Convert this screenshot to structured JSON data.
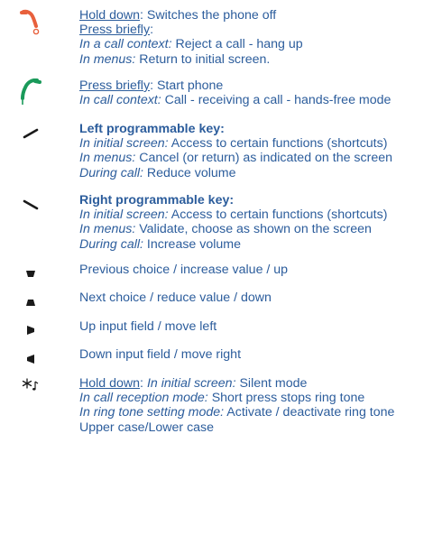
{
  "colors": {
    "text": "#2c5d9c",
    "end_key": "#e8603c",
    "call_key": "#1a9a5a",
    "dark": "#1a1a1a"
  },
  "entries": [
    {
      "icon": "end-call-icon",
      "lines": [
        [
          {
            "t": "Hold down",
            "s": "u"
          },
          {
            "t": ": Switches the phone off",
            "s": ""
          }
        ],
        [
          {
            "t": "Press briefly",
            "s": "u"
          },
          {
            "t": ":",
            "s": ""
          }
        ],
        [
          {
            "t": "In a call context:",
            "s": "i"
          },
          {
            "t": " Reject a call - hang up",
            "s": ""
          }
        ],
        [
          {
            "t": "In menus:",
            "s": "i"
          },
          {
            "t": " Return to initial screen.",
            "s": ""
          }
        ]
      ]
    },
    {
      "icon": "call-icon",
      "lines": [
        [
          {
            "t": "Press briefly",
            "s": "u"
          },
          {
            "t": ": Start phone",
            "s": ""
          }
        ],
        [
          {
            "t": "In call context:",
            "s": "i"
          },
          {
            "t": " Call - receiving a call - hands-free mode",
            "s": ""
          }
        ]
      ]
    },
    {
      "icon": "left-softkey-icon",
      "lines": [
        [
          {
            "t": "Left programmable key:",
            "s": "b"
          }
        ],
        [
          {
            "t": "In initial screen:",
            "s": "i"
          },
          {
            "t": " Access to certain functions (shortcuts)",
            "s": ""
          }
        ],
        [
          {
            "t": "In menus:",
            "s": "i"
          },
          {
            "t": " Cancel (or return) as indicated on the screen",
            "s": ""
          }
        ],
        [
          {
            "t": "During call:",
            "s": "i"
          },
          {
            "t": " Reduce volume",
            "s": ""
          }
        ]
      ]
    },
    {
      "icon": "right-softkey-icon",
      "lines": [
        [
          {
            "t": "Right programmable key:",
            "s": "b"
          }
        ],
        [
          {
            "t": "In initial screen:",
            "s": "i"
          },
          {
            "t": " Access to certain functions (shortcuts)",
            "s": ""
          }
        ],
        [
          {
            "t": "In menus:",
            "s": "i"
          },
          {
            "t": " Validate, choose as shown on the screen",
            "s": ""
          }
        ],
        [
          {
            "t": "During call:",
            "s": "i"
          },
          {
            "t": " Increase volume",
            "s": ""
          }
        ]
      ]
    },
    {
      "icon": "nav-up-icon",
      "lines": [
        [
          {
            "t": "Previous choice / increase value / up",
            "s": ""
          }
        ]
      ]
    },
    {
      "icon": "nav-down-icon",
      "lines": [
        [
          {
            "t": "Next choice / reduce value / down",
            "s": ""
          }
        ]
      ]
    },
    {
      "icon": "nav-left-icon",
      "lines": [
        [
          {
            "t": "Up input field / move left",
            "s": ""
          }
        ]
      ]
    },
    {
      "icon": "nav-right-icon",
      "lines": [
        [
          {
            "t": "Down input field / move right",
            "s": ""
          }
        ]
      ]
    },
    {
      "icon": "star-ringtone-icon",
      "lines": [
        [
          {
            "t": "Hold down",
            "s": "u"
          },
          {
            "t": ": ",
            "s": ""
          },
          {
            "t": "In initial screen:",
            "s": "i"
          },
          {
            "t": " Silent mode",
            "s": ""
          }
        ],
        [
          {
            "t": "In call reception mode:",
            "s": "i"
          },
          {
            "t": " Short press stops ring tone",
            "s": ""
          }
        ],
        [
          {
            "t": "In ring tone setting mode:",
            "s": "i"
          },
          {
            "t": " Activate / deactivate ring tone",
            "s": ""
          }
        ],
        [
          {
            "t": "Upper case/Lower case",
            "s": ""
          }
        ]
      ]
    }
  ]
}
